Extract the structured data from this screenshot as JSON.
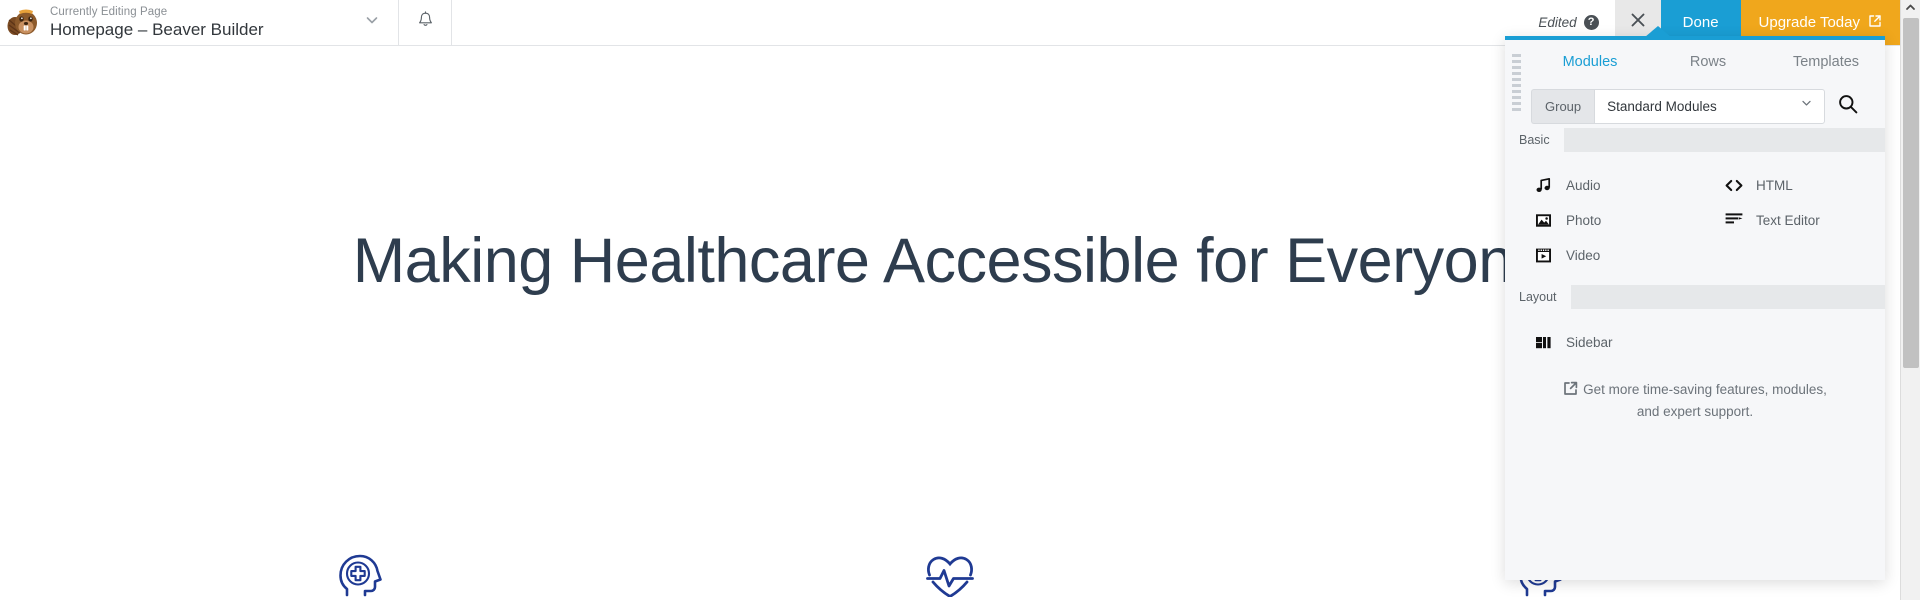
{
  "admin_bar": {
    "logo_icon": "beaver-logo-icon",
    "eyebrow": "Currently Editing Page",
    "title": "Homepage – Beaver Builder",
    "dropdown_icon": "chevron-down-icon",
    "bell_icon": "bell-icon",
    "edited_label": "Edited",
    "help_icon": "question-mark-icon",
    "help_glyph": "?",
    "close_icon": "close-x-icon",
    "done_label": "Done",
    "upgrade_label": "Upgrade Today",
    "upgrade_icon": "external-link-icon"
  },
  "page": {
    "heading": "Making Healthcare Accessible for Everyone",
    "heading_color": "#2e3d4e",
    "features": [
      {
        "icon": "head-medical-cross-icon",
        "color": "#1f3a93"
      },
      {
        "icon": "heart-pulse-icon",
        "color": "#1f3a93"
      },
      {
        "icon": "head-medical-cross-icon",
        "color": "#1f3a93"
      }
    ]
  },
  "panel": {
    "accent_color": "#1a9ed4",
    "drag_handle_icon": "drag-handle-icon",
    "tabs": [
      {
        "label": "Modules",
        "active": true
      },
      {
        "label": "Rows",
        "active": false
      },
      {
        "label": "Templates",
        "active": false
      }
    ],
    "toolbar": {
      "group_label": "Group",
      "group_value": "Standard Modules",
      "group_options": [
        "Standard Modules"
      ],
      "caret_icon": "chevron-down-icon",
      "search_icon": "search-icon"
    },
    "sections": [
      {
        "title": "Basic",
        "modules": [
          {
            "label": "Audio",
            "icon": "music-note-icon"
          },
          {
            "label": "HTML",
            "icon": "code-brackets-icon"
          },
          {
            "label": "Photo",
            "icon": "image-icon"
          },
          {
            "label": "Text Editor",
            "icon": "text-lines-icon"
          },
          {
            "label": "Video",
            "icon": "video-play-icon"
          }
        ]
      },
      {
        "title": "Layout",
        "modules": [
          {
            "label": "Sidebar",
            "icon": "sidebar-layout-icon"
          }
        ]
      }
    ],
    "footer": {
      "icon": "external-link-icon",
      "line1": "Get more time-saving features, modules,",
      "line2": "and expert support."
    }
  },
  "scrollbar": {
    "up_arrow_icon": "chevron-up-icon"
  }
}
